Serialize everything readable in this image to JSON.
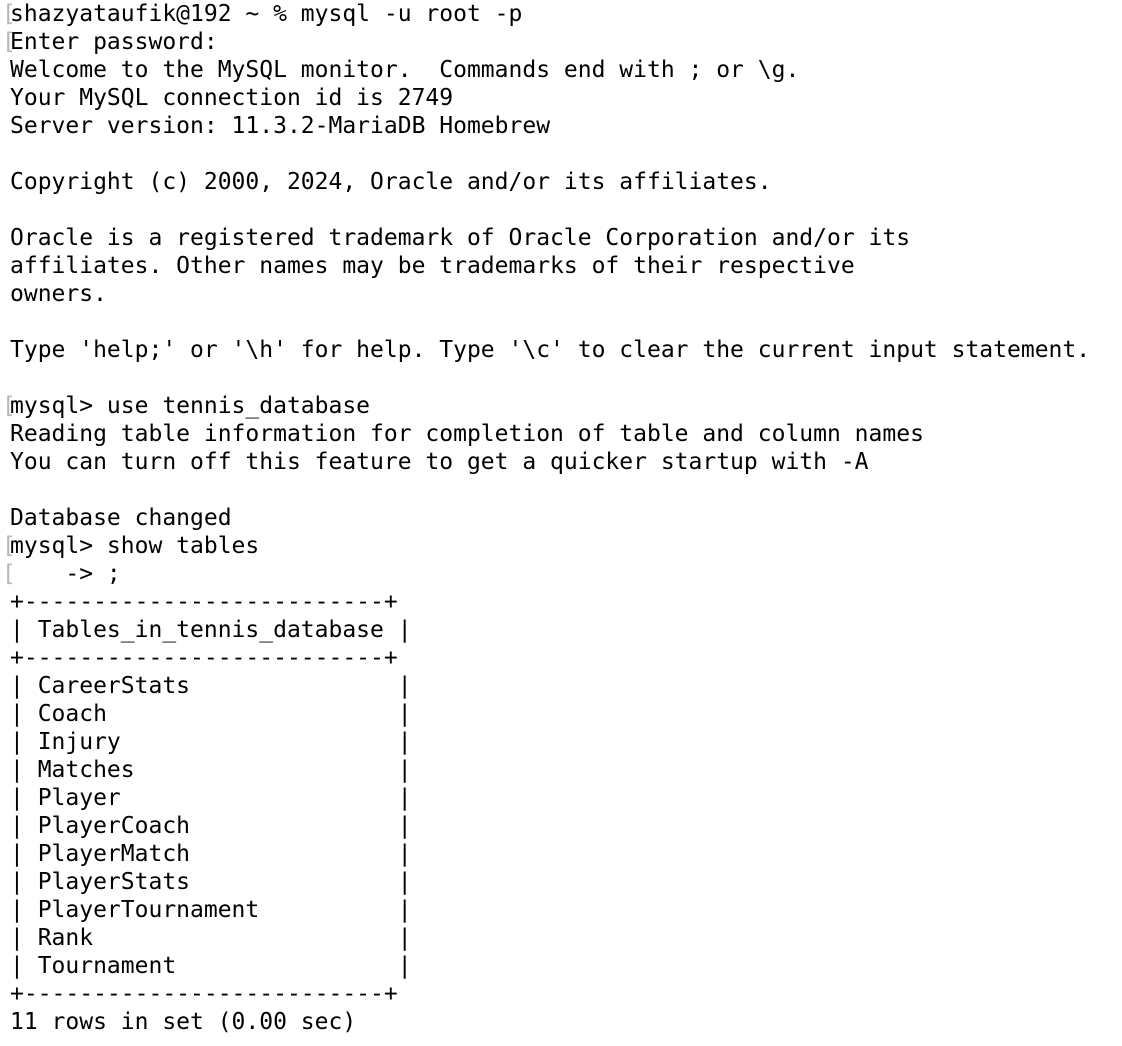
{
  "colors": {
    "background": "#ffffff",
    "text": "#000000",
    "gutter_mark": "#b8b8b8"
  },
  "terminal": {
    "gutter_mark": "[",
    "lines": [
      {
        "text": "shazyataufik@192 ~ % mysql -u root -p",
        "marked": true,
        "kind": "shell-prompt"
      },
      {
        "text": "Enter password:",
        "marked": true,
        "kind": "output"
      },
      {
        "text": "Welcome to the MySQL monitor.  Commands end with ; or \\g.",
        "marked": false,
        "kind": "output"
      },
      {
        "text": "Your MySQL connection id is 2749",
        "marked": false,
        "kind": "output"
      },
      {
        "text": "Server version: 11.3.2-MariaDB Homebrew",
        "marked": false,
        "kind": "output"
      },
      {
        "text": "",
        "marked": false,
        "kind": "blank"
      },
      {
        "text": "Copyright (c) 2000, 2024, Oracle and/or its affiliates.",
        "marked": false,
        "kind": "output"
      },
      {
        "text": "",
        "marked": false,
        "kind": "blank"
      },
      {
        "text": "Oracle is a registered trademark of Oracle Corporation and/or its",
        "marked": false,
        "kind": "output"
      },
      {
        "text": "affiliates. Other names may be trademarks of their respective",
        "marked": false,
        "kind": "output"
      },
      {
        "text": "owners.",
        "marked": false,
        "kind": "output"
      },
      {
        "text": "",
        "marked": false,
        "kind": "blank"
      },
      {
        "text": "Type 'help;' or '\\h' for help. Type '\\c' to clear the current input statement.",
        "marked": false,
        "kind": "output"
      },
      {
        "text": "",
        "marked": false,
        "kind": "blank"
      },
      {
        "text": "mysql> use tennis_database",
        "marked": true,
        "kind": "mysql-prompt"
      },
      {
        "text": "Reading table information for completion of table and column names",
        "marked": false,
        "kind": "output"
      },
      {
        "text": "You can turn off this feature to get a quicker startup with -A",
        "marked": false,
        "kind": "output"
      },
      {
        "text": "",
        "marked": false,
        "kind": "blank"
      },
      {
        "text": "Database changed",
        "marked": false,
        "kind": "output"
      },
      {
        "text": "mysql> show tables",
        "marked": true,
        "kind": "mysql-prompt"
      },
      {
        "text": "    -> ;",
        "marked": true,
        "kind": "continuation-prompt"
      },
      {
        "text": "+--------------------------+",
        "marked": false,
        "kind": "table-border"
      },
      {
        "text": "| Tables_in_tennis_database |",
        "marked": false,
        "kind": "table-header"
      },
      {
        "text": "+--------------------------+",
        "marked": false,
        "kind": "table-border"
      },
      {
        "text": "| CareerStats               |",
        "marked": false,
        "kind": "table-row"
      },
      {
        "text": "| Coach                     |",
        "marked": false,
        "kind": "table-row"
      },
      {
        "text": "| Injury                    |",
        "marked": false,
        "kind": "table-row"
      },
      {
        "text": "| Matches                   |",
        "marked": false,
        "kind": "table-row"
      },
      {
        "text": "| Player                    |",
        "marked": false,
        "kind": "table-row"
      },
      {
        "text": "| PlayerCoach               |",
        "marked": false,
        "kind": "table-row"
      },
      {
        "text": "| PlayerMatch               |",
        "marked": false,
        "kind": "table-row"
      },
      {
        "text": "| PlayerStats               |",
        "marked": false,
        "kind": "table-row"
      },
      {
        "text": "| PlayerTournament          |",
        "marked": false,
        "kind": "table-row"
      },
      {
        "text": "| Rank                      |",
        "marked": false,
        "kind": "table-row"
      },
      {
        "text": "| Tournament                |",
        "marked": false,
        "kind": "table-row"
      },
      {
        "text": "+--------------------------+",
        "marked": false,
        "kind": "table-border"
      },
      {
        "text": "11 rows in set (0.00 sec)",
        "marked": false,
        "kind": "output"
      }
    ]
  }
}
